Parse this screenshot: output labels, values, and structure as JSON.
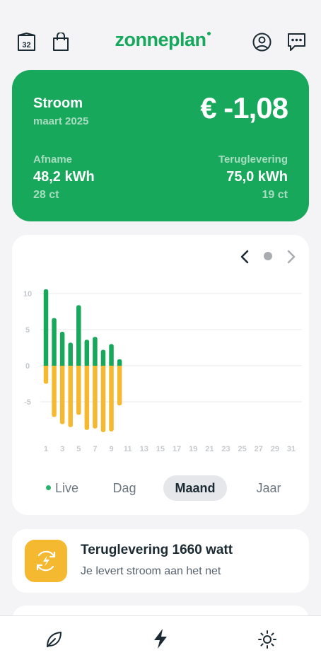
{
  "header": {
    "calendar_day": "32",
    "logo": "zonneplan"
  },
  "summary": {
    "title": "Stroom",
    "period": "maart 2025",
    "amount": "€ -1,08",
    "afname_label": "Afname",
    "afname_value": "48,2 kWh",
    "afname_price": "28 ct",
    "terug_label": "Teruglevering",
    "terug_value": "75,0 kWh",
    "terug_price": "19 ct",
    "color": "#17a85b"
  },
  "tabs": {
    "live": "Live",
    "dag": "Dag",
    "maand": "Maand",
    "jaar": "Jaar",
    "selected": "Maand"
  },
  "chart_data": {
    "type": "bar",
    "x": [
      1,
      2,
      3,
      4,
      5,
      6,
      7,
      8,
      9,
      10,
      11,
      12,
      13,
      14,
      15,
      16,
      17,
      18,
      19,
      20,
      21,
      22,
      23,
      24,
      25,
      26,
      27,
      28,
      29,
      30,
      31
    ],
    "x_tick_labels": [
      "1",
      "3",
      "5",
      "7",
      "9",
      "11",
      "13",
      "15",
      "17",
      "19",
      "21",
      "23",
      "25",
      "27",
      "29",
      "31"
    ],
    "y_ticks": [
      10,
      5,
      0,
      -5
    ],
    "ylim": [
      -10,
      11
    ],
    "grid": true,
    "series": [
      {
        "color": "#17a85b",
        "values": [
          10.6,
          6.6,
          4.7,
          3.2,
          8.4,
          3.6,
          4.0,
          2.2,
          3.0,
          0.9
        ]
      },
      {
        "color": "#f5b931",
        "values": [
          -2.5,
          -7.1,
          -8.1,
          -8.5,
          -6.8,
          -8.9,
          -8.7,
          -9.2,
          -9.1,
          -5.5
        ]
      }
    ]
  },
  "status": {
    "title": "Teruglevering 1660 watt",
    "subtitle": "Je levert stroom aan het net"
  },
  "colors": {
    "brand": "#16a85c",
    "accent": "#f5b931"
  }
}
